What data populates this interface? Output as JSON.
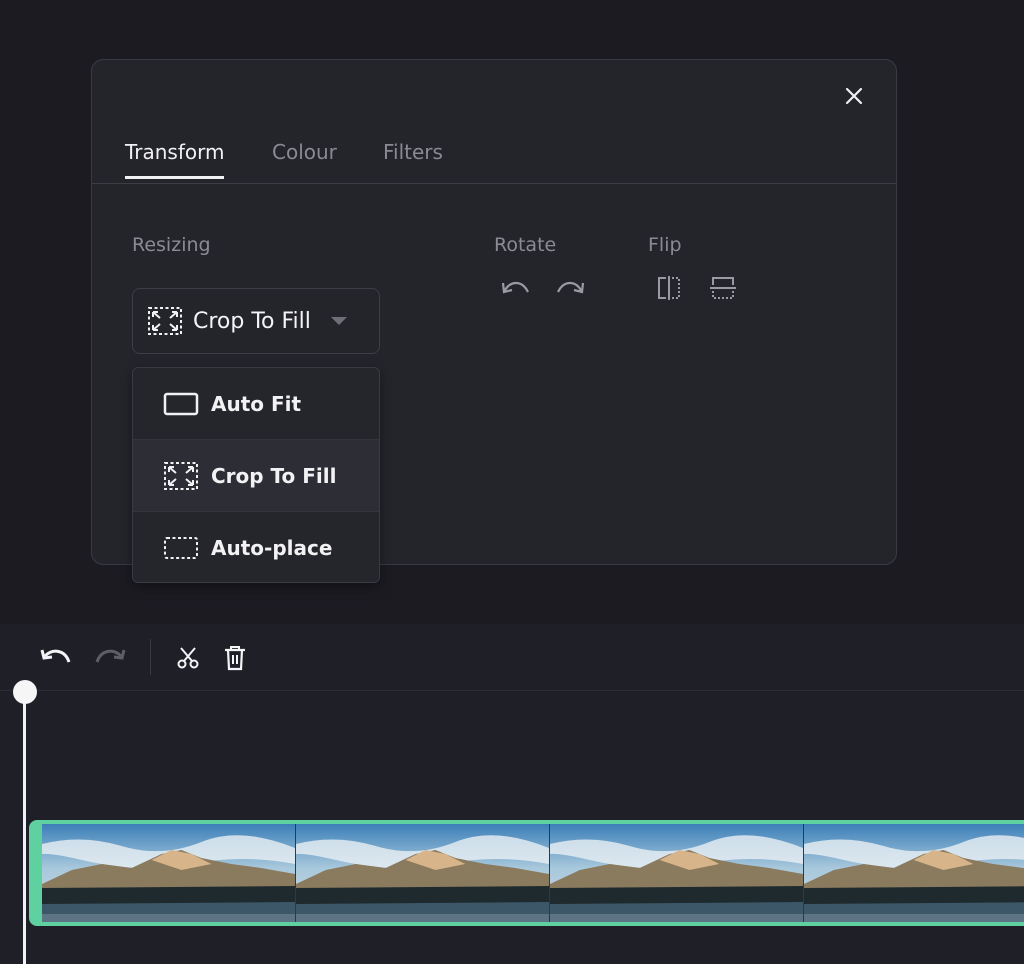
{
  "tabs": [
    {
      "label": "Transform",
      "active": true
    },
    {
      "label": "Colour",
      "active": false
    },
    {
      "label": "Filters",
      "active": false
    }
  ],
  "sections": {
    "resizing": "Resizing",
    "rotate": "Rotate",
    "flip": "Flip"
  },
  "resize_select": {
    "value": "Crop To Fill",
    "icon": "crop-to-fill-icon"
  },
  "dropdown": {
    "items": [
      {
        "label": "Auto Fit",
        "icon": "auto-fit-icon",
        "selected": false
      },
      {
        "label": "Crop To Fill",
        "icon": "crop-to-fill-icon",
        "selected": true
      },
      {
        "label": "Auto-place",
        "icon": "auto-place-icon",
        "selected": false
      }
    ]
  },
  "icons": {
    "close": "close-icon",
    "rotate_left": "rotate-left-icon",
    "rotate_right": "rotate-right-icon",
    "flip_horizontal": "flip-horizontal-icon",
    "flip_vertical": "flip-vertical-icon",
    "undo": "undo-icon",
    "redo": "redo-icon",
    "split": "scissors-icon",
    "delete": "trash-icon"
  },
  "colors": {
    "accent_clip": "#5fd0a0",
    "panel_bg": "#24242b",
    "page_bg": "#1c1b22"
  }
}
